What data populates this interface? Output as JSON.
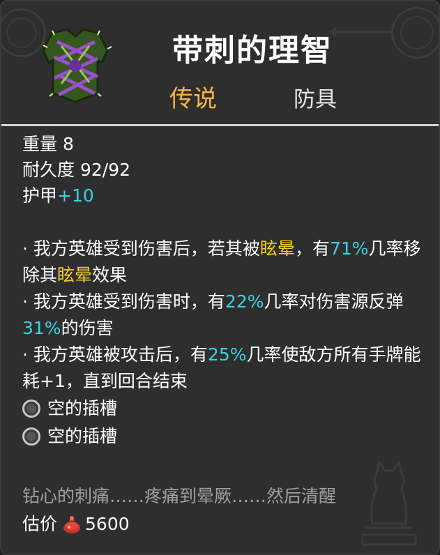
{
  "item": {
    "name": "带刺的理智",
    "rarity": "传说",
    "category": "防具",
    "icon": "thorny-vine-armor-icon"
  },
  "stats": {
    "weight_label": "重量",
    "weight_value": "8",
    "durability_label": "耐久度",
    "durability_value": "92/92",
    "armor_label": "护甲",
    "armor_value": "+10"
  },
  "effects": [
    {
      "bullet": "·",
      "p1": "我方英雄受到伤害后，若其被",
      "k1": "眩晕",
      "p2": "，有",
      "n1": "71%",
      "p3": "几率移除其",
      "k2": "眩晕",
      "p4": "效果"
    },
    {
      "bullet": "·",
      "p1": "我方英雄受到伤害时，有",
      "n1": "22%",
      "p2": "几率对伤害源反弹",
      "n2": "31%",
      "p3": "的伤害"
    },
    {
      "bullet": "·",
      "p1": "我方英雄被攻击后，有",
      "n1": "25%",
      "p2": "几率使敌方所有手牌能耗+1，直到回合结束"
    }
  ],
  "sockets": [
    {
      "label": "空的插槽",
      "icon": "empty-socket-icon"
    },
    {
      "label": "空的插槽",
      "icon": "empty-socket-icon"
    }
  ],
  "flavor_text": "钻心的刺痛……疼痛到晕厥……然后清醒",
  "price": {
    "label": "估价",
    "value": "5600",
    "icon": "red-coin-pouch-icon"
  },
  "colors": {
    "background": "#2e2e2e",
    "rarity_legendary": "#ffb545",
    "number_highlight": "#3ad3e6",
    "keyword_highlight": "#f5cd28",
    "flavor": "#a0a0a0"
  }
}
